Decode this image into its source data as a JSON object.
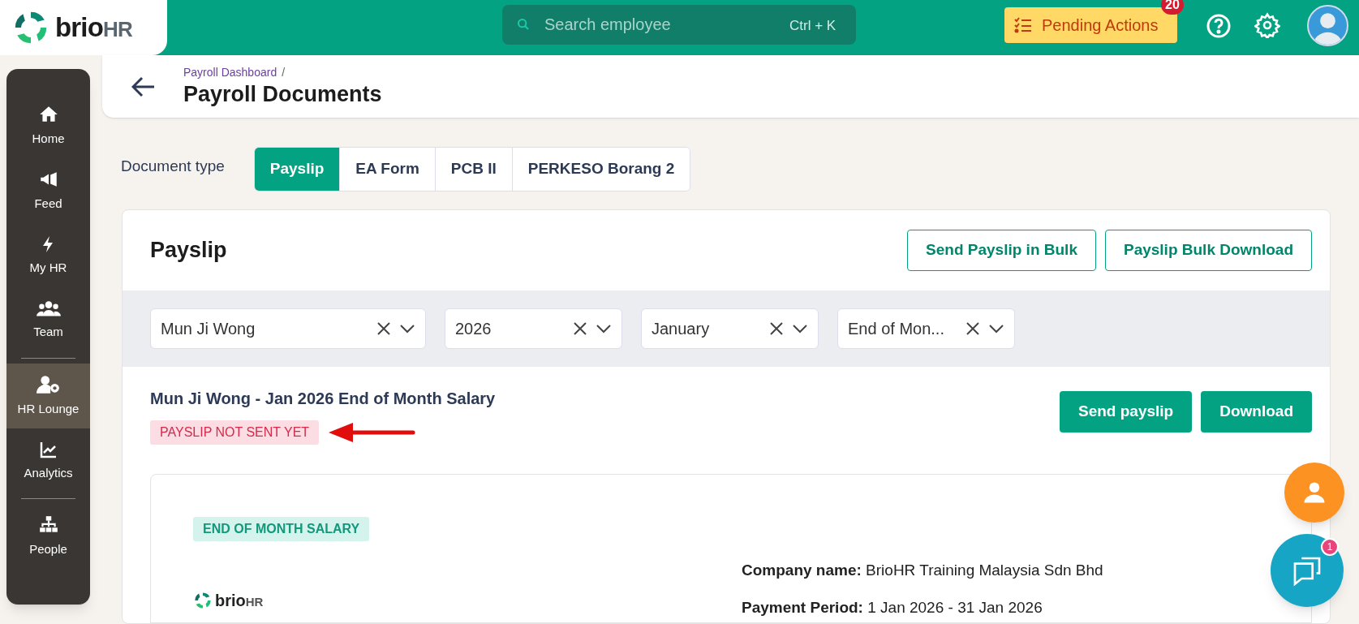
{
  "header": {
    "logo": {
      "brand": "brio",
      "suffix": "HR"
    },
    "search": {
      "placeholder": "Search employee",
      "shortcut": "Ctrl + K"
    },
    "pending_actions": {
      "label": "Pending Actions",
      "count": "20"
    }
  },
  "sidebar": {
    "items": [
      {
        "label": "Home",
        "selected": false,
        "divider_after": false
      },
      {
        "label": "Feed",
        "selected": false,
        "divider_after": false
      },
      {
        "label": "My HR",
        "selected": false,
        "divider_after": false
      },
      {
        "label": "Team",
        "selected": false,
        "divider_after": true
      },
      {
        "label": "HR Lounge",
        "selected": true,
        "divider_after": false
      },
      {
        "label": "Analytics",
        "selected": false,
        "divider_after": true
      },
      {
        "label": "People",
        "selected": false,
        "divider_after": false
      }
    ]
  },
  "page": {
    "breadcrumb": "Payroll Dashboard",
    "breadcrumb_separator": "/",
    "title": "Payroll Documents"
  },
  "document_type": {
    "label": "Document type",
    "tabs": [
      {
        "label": "Payslip",
        "selected": true
      },
      {
        "label": "EA Form",
        "selected": false
      },
      {
        "label": "PCB II",
        "selected": false
      },
      {
        "label": "PERKESO Borang 2",
        "selected": false
      }
    ]
  },
  "payslip_card": {
    "title": "Payslip",
    "actions": [
      "Send Payslip in Bulk",
      "Payslip Bulk Download"
    ],
    "filters": [
      {
        "value": "Mun Ji Wong"
      },
      {
        "value": "2026"
      },
      {
        "value": "January"
      },
      {
        "value": "End of Mon..."
      }
    ],
    "record": {
      "title": "Mun Ji Wong - Jan 2026 End of Month Salary",
      "status": "PAYSLIP NOT SENT YET",
      "buttons": [
        "Send payslip",
        "Download"
      ]
    },
    "document": {
      "tag": "END OF MONTH SALARY",
      "logo": {
        "brand": "brio",
        "suffix": "HR"
      },
      "fields": [
        {
          "label": "Company name:",
          "value": "BrioHR Training Malaysia Sdn Bhd"
        },
        {
          "label": "Payment Period:",
          "value": "1 Jan 2026 - 31 Jan 2026"
        }
      ]
    }
  },
  "chat": {
    "unread": "1"
  }
}
